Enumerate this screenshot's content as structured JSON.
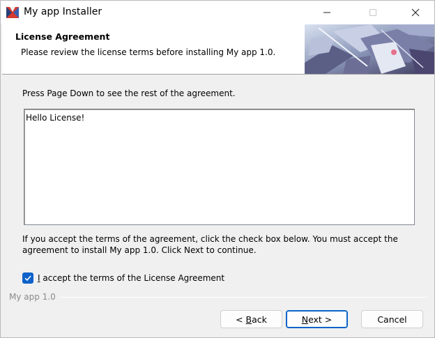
{
  "window": {
    "title": "My app Installer"
  },
  "header": {
    "title": "License Agreement",
    "subtitle": "Please review the license terms before installing My app 1.0."
  },
  "body": {
    "instruction": "Press Page Down to see the rest of the agreement.",
    "license_text": "Hello License!",
    "accept_text": "If you accept the terms of the agreement, click the check box below. You must accept the agreement to install My app 1.0. Click Next to continue.",
    "checkbox": {
      "checked": true,
      "label_accel": "I",
      "label_rest": " accept the terms of the License Agreement"
    }
  },
  "footer": {
    "brand": "My app 1.0"
  },
  "buttons": {
    "back_prefix": "< ",
    "back_accel": "B",
    "back_rest": "ack",
    "next_accel": "N",
    "next_rest": "ext >",
    "cancel": "Cancel"
  },
  "colors": {
    "accent": "#0e62c9",
    "background": "#f0f0f0"
  }
}
